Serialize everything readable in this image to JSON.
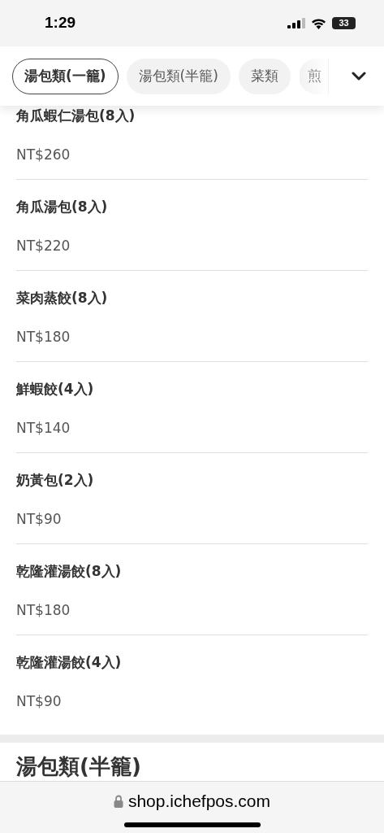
{
  "status_bar": {
    "time": "1:29",
    "battery": "33"
  },
  "category_tabs": [
    {
      "label": "湯包類(一籠)",
      "selected": true
    },
    {
      "label": "湯包類(半籠)",
      "selected": false
    },
    {
      "label": "菜類",
      "selected": false
    },
    {
      "label": "煎",
      "selected": false
    }
  ],
  "items": [
    {
      "name": "角瓜蝦仁湯包(8入)",
      "price": "NT$260"
    },
    {
      "name": "角瓜湯包(8入)",
      "price": "NT$220"
    },
    {
      "name": "菜肉蒸餃(8入)",
      "price": "NT$180"
    },
    {
      "name": "鮮蝦餃(4入)",
      "price": "NT$140"
    },
    {
      "name": "奶黃包(2入)",
      "price": "NT$90"
    },
    {
      "name": "乾隆灌湯餃(8入)",
      "price": "NT$180"
    },
    {
      "name": "乾隆灌湯餃(4入)",
      "price": "NT$90"
    }
  ],
  "next_section": {
    "title": "湯包類(半籠)"
  },
  "address_bar": {
    "url": "shop.ichefpos.com"
  }
}
